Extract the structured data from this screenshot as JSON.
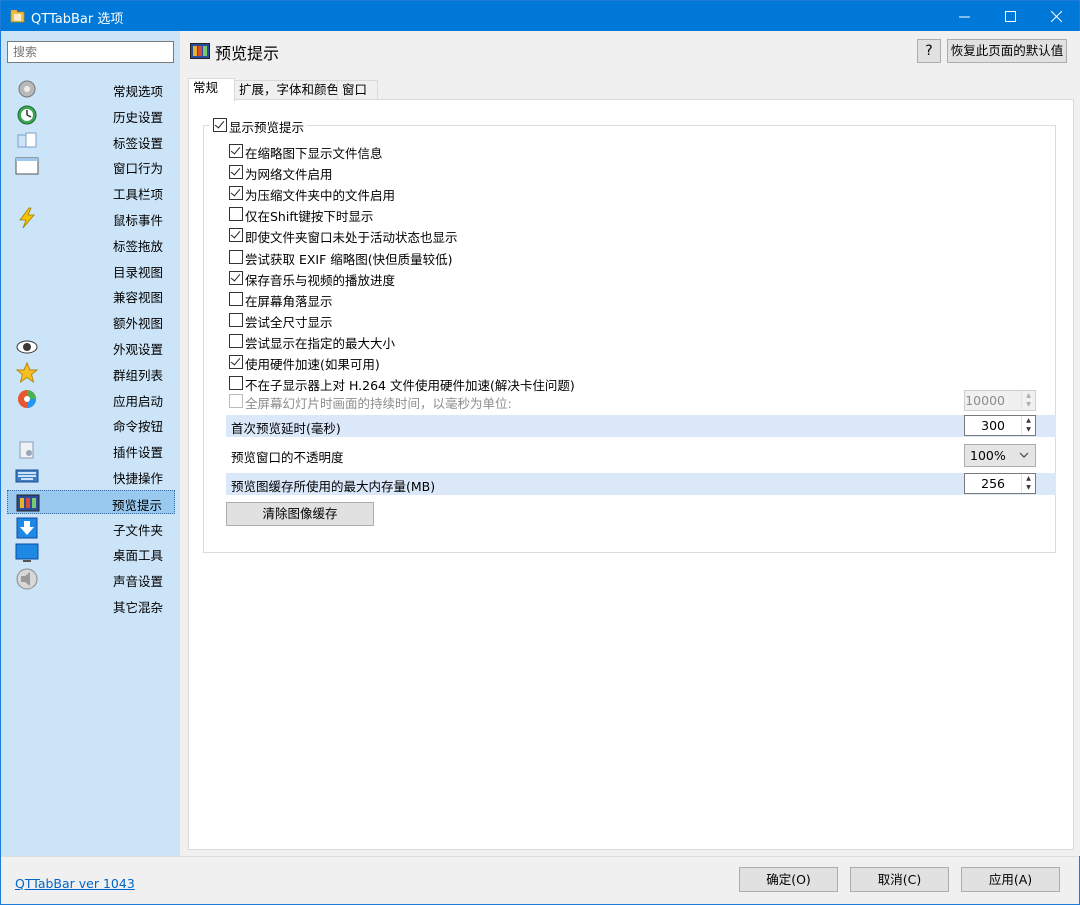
{
  "window": {
    "title": "QTTabBar 选项",
    "controls": {
      "minimize": "—",
      "maximize": "☐",
      "close": "✕"
    }
  },
  "sidebar": {
    "search_placeholder": "搜索",
    "items": [
      {
        "label": "常规选项",
        "icon": "gear-icon"
      },
      {
        "label": "历史设置",
        "icon": "history-clock-icon"
      },
      {
        "label": "标签设置",
        "icon": "tabs-icon"
      },
      {
        "label": "窗口行为",
        "icon": "window-icon"
      },
      {
        "label": "工具栏项",
        "icon": ""
      },
      {
        "label": "鼠标事件",
        "icon": "lightning-icon"
      },
      {
        "label": "标签拖放",
        "icon": ""
      },
      {
        "label": "目录视图",
        "icon": ""
      },
      {
        "label": "兼容视图",
        "icon": ""
      },
      {
        "label": "额外视图",
        "icon": ""
      },
      {
        "label": "外观设置",
        "icon": "eye-icon"
      },
      {
        "label": "群组列表",
        "icon": "star-icon"
      },
      {
        "label": "应用启动",
        "icon": "app-launch-icon"
      },
      {
        "label": "命令按钮",
        "icon": ""
      },
      {
        "label": "插件设置",
        "icon": "plugin-icon"
      },
      {
        "label": "快捷操作",
        "icon": "keyboard-icon"
      },
      {
        "label": "预览提示",
        "icon": "preview-icon"
      },
      {
        "label": "子文件夹",
        "icon": "download-arrow-icon"
      },
      {
        "label": "桌面工具",
        "icon": "desktop-icon"
      },
      {
        "label": "声音设置",
        "icon": "speaker-icon"
      },
      {
        "label": "其它混杂",
        "icon": ""
      }
    ],
    "selected_index": 16
  },
  "header": {
    "title": "预览提示",
    "help_label": "?",
    "reset_label": "恢复此页面的默认值"
  },
  "tabs": [
    "常规",
    "扩展，字体和颜色",
    "窗口"
  ],
  "active_tab": 0,
  "options": {
    "group_label": "显示预览提示",
    "group_checked": true,
    "checkboxes": [
      {
        "label": "在缩略图下显示文件信息",
        "checked": true
      },
      {
        "label": "为网络文件启用",
        "checked": true
      },
      {
        "label": "为压缩文件夹中的文件启用",
        "checked": true
      },
      {
        "label": "仅在Shift键按下时显示",
        "checked": false
      },
      {
        "label": "即使文件夹窗口未处于活动状态也显示",
        "checked": true
      },
      {
        "label": "尝试获取 EXIF 缩略图(快但质量较低)",
        "checked": false
      },
      {
        "label": "保存音乐与视频的播放进度",
        "checked": true
      },
      {
        "label": "在屏幕角落显示",
        "checked": false
      },
      {
        "label": "尝试全尺寸显示",
        "checked": false
      },
      {
        "label": "尝试显示在指定的最大大小",
        "checked": false
      },
      {
        "label": "使用硬件加速(如果可用)",
        "checked": true
      },
      {
        "label": "不在子显示器上对 H.264 文件使用硬件加速(解决卡住问题)",
        "checked": false
      }
    ],
    "slideshow": {
      "label": "全屏幕幻灯片时画面的持续时间，以毫秒为单位:",
      "value": "10000",
      "checked": false,
      "enabled": false
    },
    "first_delay": {
      "label": "首次预览延时(毫秒)",
      "value": "300"
    },
    "opacity": {
      "label": "预览窗口的不透明度",
      "value": "100%"
    },
    "cache_size": {
      "label": "预览图缓存所使用的最大内存量(MB)",
      "value": "256"
    },
    "clear_cache_label": "清除图像缓存"
  },
  "footer": {
    "version": "QTTabBar ver 1043",
    "ok": "确定(O)",
    "cancel": "取消(C)",
    "apply": "应用(A)"
  }
}
